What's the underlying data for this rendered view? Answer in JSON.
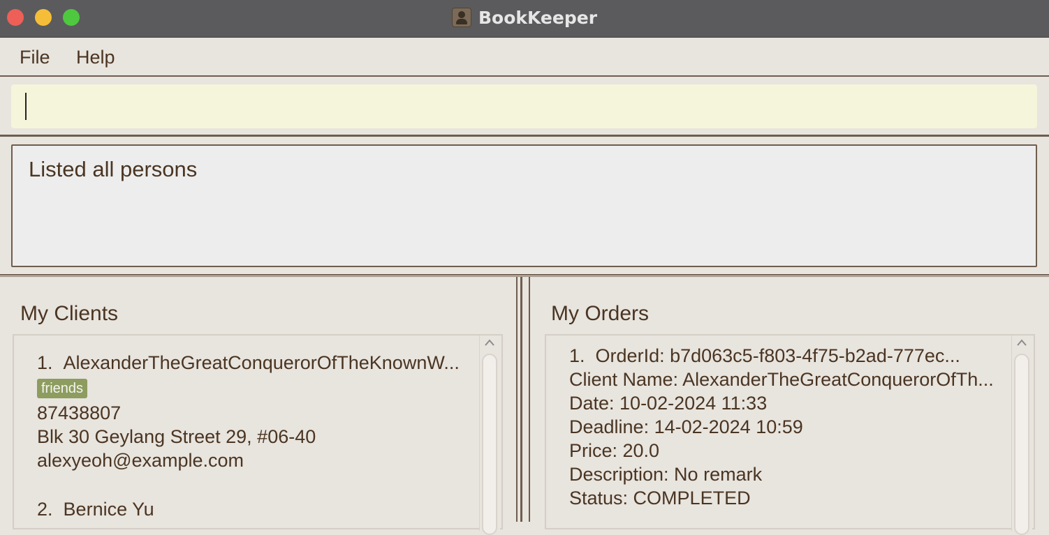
{
  "window": {
    "title": "BookKeeper"
  },
  "menubar": {
    "file": "File",
    "help": "Help"
  },
  "command": {
    "value": "",
    "placeholder": ""
  },
  "result": {
    "text": "Listed all persons"
  },
  "clients": {
    "title": "My Clients",
    "items": [
      {
        "index": "1.",
        "name": "AlexanderTheGreatConquerorOfTheKnownW...",
        "tag": "friends",
        "phone": "87438807",
        "address": "Blk 30 Geylang Street 29, #06-40",
        "email": "alexyeoh@example.com"
      },
      {
        "index": "2.",
        "name": "Bernice Yu"
      }
    ]
  },
  "orders": {
    "title": "My Orders",
    "items": [
      {
        "index": "1.",
        "order_id": "OrderId: b7d063c5-f803-4f75-b2ad-777ec...",
        "client_name": "Client Name: AlexanderTheGreatConquerorOfTh...",
        "date": "Date: 10-02-2024 11:33",
        "deadline": "Deadline: 14-02-2024 10:59",
        "price": "Price: 20.0",
        "description": "Description: No remark",
        "status": "Status: COMPLETED"
      }
    ]
  }
}
